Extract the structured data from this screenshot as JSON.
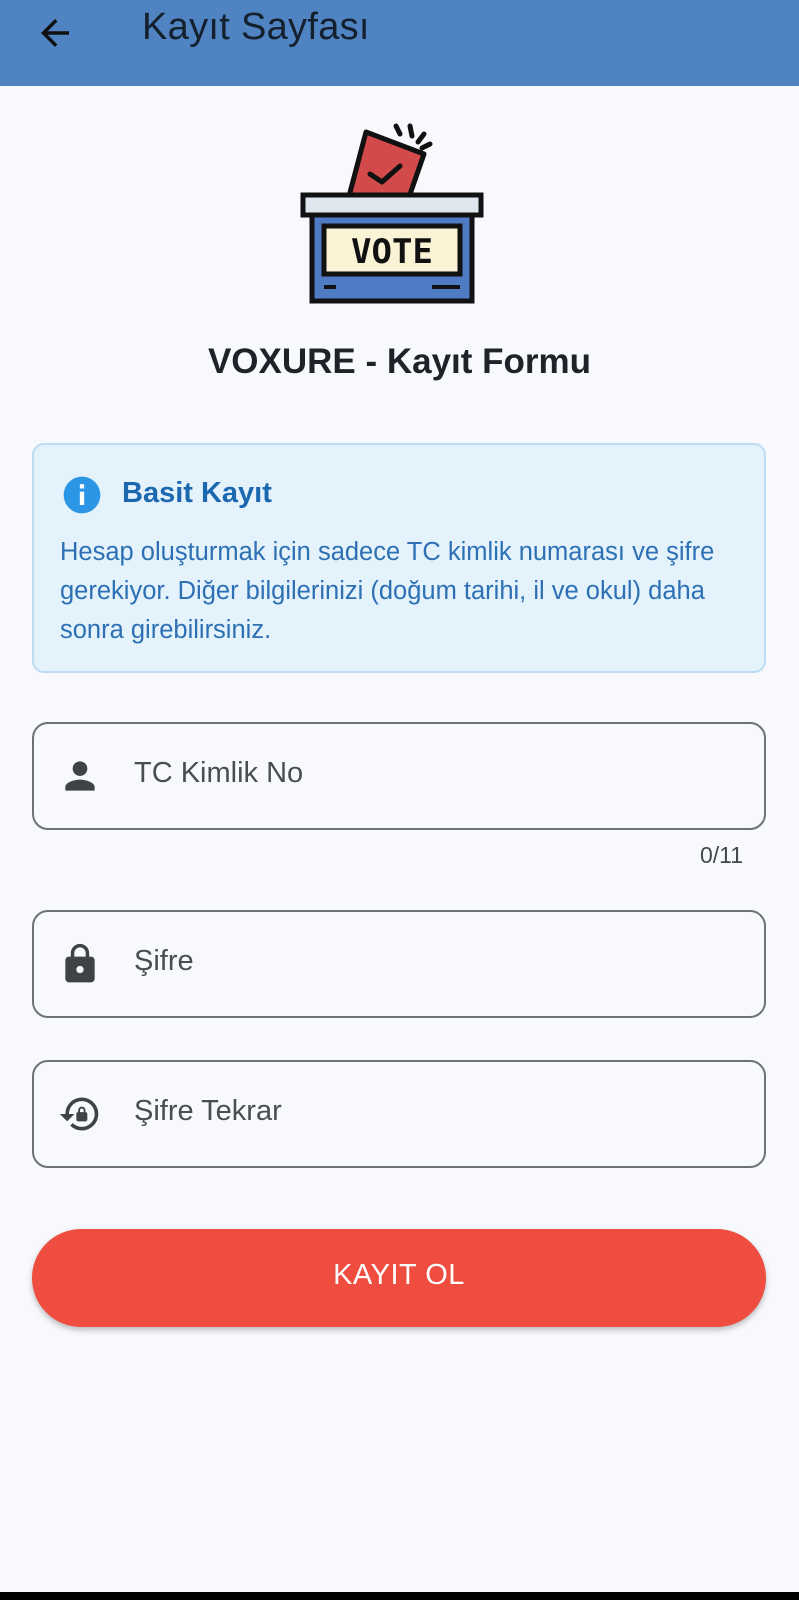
{
  "appbar": {
    "title": "Kayıt Sayfası",
    "back_icon": "arrow-back-icon",
    "color": "#5083c1"
  },
  "logo": {
    "label": "VOTE",
    "icon": "ballot-box-icon"
  },
  "form_title": "VOXURE - Kayıt Formu",
  "info": {
    "icon": "info-icon",
    "title": "Basit Kayıt",
    "text": "Hesap oluşturmak için sadece TC kimlik numarası ve şifre gerekiyor. Diğer bilgilerinizi (doğum tarihi, il ve okul) daha sonra girebilirsiniz."
  },
  "fields": {
    "tc": {
      "placeholder": "TC Kimlik No",
      "value": "",
      "counter": "0/11",
      "icon": "person-icon"
    },
    "password": {
      "placeholder": "Şifre",
      "value": "",
      "icon": "lock-icon"
    },
    "password_repeat": {
      "placeholder": "Şifre Tekrar",
      "value": "",
      "icon": "lock-reset-icon"
    }
  },
  "submit": {
    "label": "KAYIT OL",
    "color": "#ee4d3f"
  }
}
